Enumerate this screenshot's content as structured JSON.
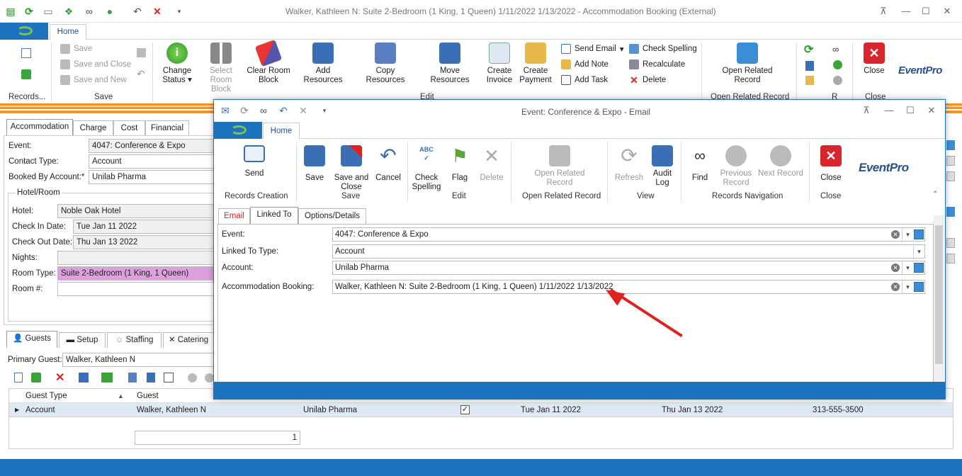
{
  "window": {
    "title": "Walker, Kathleen N: Suite 2-Bedroom (1 King, 1 Queen) 1/11/2022 1/13/2022  - Accommodation Booking (External)"
  },
  "ribbon": {
    "tab_home": "Home",
    "records_group": "Records...",
    "save": "Save",
    "save_close": "Save and Close",
    "save_new": "Save and New",
    "save_group": "Save",
    "change_status": "Change Status",
    "select_room_block": "Select Room Block",
    "clear_room_block": "Clear Room Block",
    "add_resources": "Add Resources",
    "copy_resources": "Copy Resources",
    "move_resources": "Move Resources",
    "create_invoice": "Create Invoice",
    "create_payment": "Create Payment",
    "send_email": "Send Email",
    "add_note": "Add Note",
    "add_task": "Add Task",
    "check_spelling": "Check Spelling",
    "recalculate": "Recalculate",
    "delete": "Delete",
    "edit_group": "Edit",
    "open_related_record": "Open Related Record",
    "open_related_group": "Open Related Record",
    "r_group": "R",
    "close": "Close",
    "close_group": "Close",
    "logo": "EventPro"
  },
  "detail_tabs": [
    "Accommodation",
    "Charge",
    "Cost",
    "Financial"
  ],
  "form": {
    "event_label": "Event:",
    "event_value": "4047: Conference & Expo",
    "contact_type_label": "Contact Type:",
    "contact_type_value": "Account",
    "booked_by_label": "Booked By Account:*",
    "booked_by_value": "Unilab Pharma",
    "hotel_room_title": "Hotel/Room",
    "hotel_label": "Hotel:",
    "hotel_value": "Noble Oak Hotel",
    "check_in_label": "Check In Date:",
    "check_in_value": "Tue Jan 11 2022",
    "check_out_label": "Check Out Date:",
    "check_out_value": "Thu Jan 13 2022",
    "nights_label": "Nights:",
    "room_type_label": "Room Type:",
    "room_type_value": "Suite 2-Bedroom (1 King, 1 Queen)",
    "room_no_label": "Room #:"
  },
  "lower_tabs": [
    "Guests",
    "Setup",
    "Staffing",
    "Catering"
  ],
  "guests": {
    "primary_guest_label": "Primary Guest:",
    "primary_guest_value": "Walker, Kathleen N",
    "columns": [
      "Guest Type",
      "Guest"
    ],
    "row": {
      "guest_type": "Account",
      "guest": "Walker, Kathleen N",
      "account": "Unilab Pharma",
      "check_in": "Tue Jan 11 2022",
      "check_out": "Thu Jan 13 2022",
      "phone": "313-555-3500"
    },
    "footer_count": "1"
  },
  "modal": {
    "title": "Event: Conference & Expo - Email",
    "tab_home": "Home",
    "send": "Send",
    "records_creation": "Records Creation",
    "save": "Save",
    "save_close": "Save and Close",
    "cancel": "Cancel",
    "save_group": "Save",
    "check_spelling": "Check Spelling",
    "flag": "Flag",
    "delete": "Delete",
    "edit_group": "Edit",
    "open_related_record": "Open Related Record",
    "open_related_group": "Open Related Record",
    "refresh": "Refresh",
    "audit_log": "Audit Log",
    "view_group": "View",
    "find": "Find",
    "previous_record": "Previous Record",
    "next_record": "Next Record",
    "nav_group": "Records Navigation",
    "close": "Close",
    "close_group": "Close",
    "logo": "EventPro",
    "tabs": [
      "Email",
      "Linked To",
      "Options/Details"
    ],
    "event_label": "Event:",
    "event_value": "4047: Conference & Expo",
    "linked_type_label": "Linked To Type:",
    "linked_type_value": "Account",
    "account_label": "Account:",
    "account_value": "Unilab Pharma",
    "booking_label": "Accommodation Booking:",
    "booking_value": "Walker, Kathleen N: Suite 2-Bedroom (1 King, 1 Queen) 1/11/2022 1/13/2022"
  },
  "colors": {
    "accent": "#1e73be",
    "orange": "#f7941d",
    "room_type_highlight": "#dca0dc",
    "arrow": "#e0211d"
  }
}
